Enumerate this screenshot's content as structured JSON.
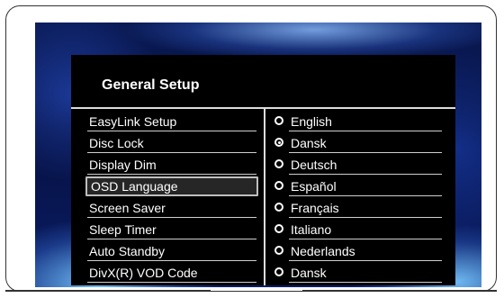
{
  "panel": {
    "title": "General Setup"
  },
  "menu": {
    "items": [
      {
        "label": "EasyLink Setup"
      },
      {
        "label": "Disc Lock"
      },
      {
        "label": "Display Dim"
      },
      {
        "label": "OSD Language",
        "selected": true
      },
      {
        "label": "Screen Saver"
      },
      {
        "label": "Sleep Timer"
      },
      {
        "label": "Auto Standby"
      },
      {
        "label": "DivX(R) VOD Code"
      }
    ]
  },
  "options": {
    "items": [
      {
        "label": "English",
        "checked": false
      },
      {
        "label": "Dansk",
        "checked": true
      },
      {
        "label": "Deutsch",
        "checked": false
      },
      {
        "label": "Español",
        "checked": false
      },
      {
        "label": "Français",
        "checked": false
      },
      {
        "label": "Italiano",
        "checked": false
      },
      {
        "label": "Nederlands",
        "checked": false
      },
      {
        "label": "Dansk",
        "checked": false
      }
    ]
  },
  "colors": {
    "screen_blue": "#0a1a55",
    "panel_bg": "#000000",
    "text": "#ffffff",
    "highlight_border": "#bfbfbf"
  }
}
